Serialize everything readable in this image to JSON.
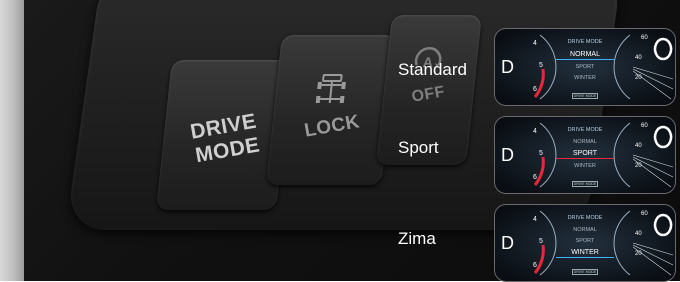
{
  "buttons": {
    "drive_line1": "DRIVE",
    "drive_line2": "MODE",
    "lock_label": "LOCK",
    "off_label": "OFF",
    "off_icon_letter": "A"
  },
  "modes": [
    {
      "label": "Standard",
      "active": "NORMAL"
    },
    {
      "label": "Sport",
      "active": "SPORT"
    },
    {
      "label": "Zima",
      "active": "WINTER"
    }
  ],
  "cluster": {
    "menu_title": "DRIVE MODE",
    "items": [
      "NORMAL",
      "SPORT",
      "WINTER"
    ],
    "left_gear": "D",
    "left_ticks": [
      "4",
      "5",
      "6"
    ],
    "right_ticks": [
      "60",
      "40",
      "20"
    ],
    "footer_box": "DRIVE MODE"
  },
  "colors": {
    "active_blue": "#3fb0ff",
    "active_red": "#e5283a"
  }
}
